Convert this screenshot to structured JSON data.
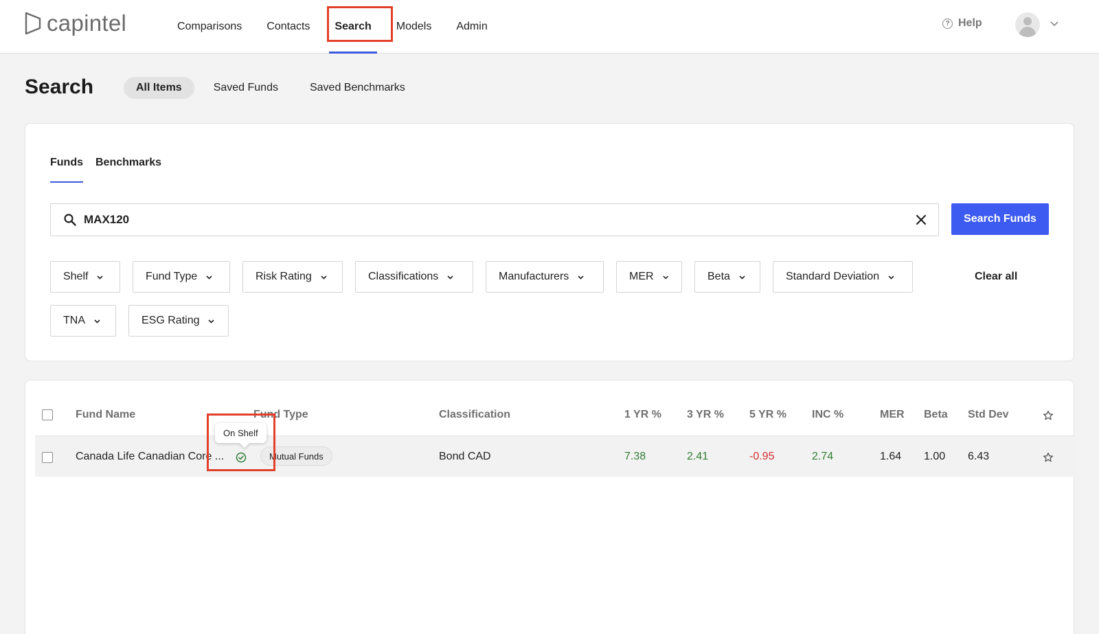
{
  "brand": {
    "name": "capintel"
  },
  "nav": {
    "items": [
      "Comparisons",
      "Contacts",
      "Search",
      "Models",
      "Admin"
    ],
    "active": "Search"
  },
  "header": {
    "help_label": "Help"
  },
  "page": {
    "title": "Search",
    "subtabs": [
      "All Items",
      "Saved Funds",
      "Saved Benchmarks"
    ],
    "active_subtab": "All Items"
  },
  "search_card": {
    "tabs": [
      "Funds",
      "Benchmarks"
    ],
    "active_tab": "Funds",
    "query": "MAX120",
    "search_button": "Search Funds",
    "filters": [
      "Shelf",
      "Fund Type",
      "Risk Rating",
      "Classifications",
      "Manufacturers",
      "MER",
      "Beta",
      "Standard Deviation",
      "TNA",
      "ESG Rating"
    ],
    "clear_all": "Clear all"
  },
  "table": {
    "headers": [
      "Fund Name",
      "Fund Type",
      "Classification",
      "1 YR %",
      "3 YR %",
      "5 YR %",
      "INC %",
      "MER",
      "Beta",
      "Std Dev"
    ],
    "rows": [
      {
        "fund_name": "Canada Life Canadian Core ...",
        "fund_type": "Mutual Funds",
        "classification": "Bond CAD",
        "yr1": "7.38",
        "yr3": "2.41",
        "yr5": "-0.95",
        "inc": "2.74",
        "mer": "1.64",
        "beta": "1.00",
        "std_dev": "6.43",
        "shelf_status": "On Shelf"
      }
    ]
  },
  "colors": {
    "accent": "#3d5af1",
    "positive": "#2e7d32",
    "negative": "#d32f2f",
    "highlight": "#e2402a"
  },
  "icons": {
    "search": "search-icon",
    "clear": "close-icon",
    "shelf": "check-circle-icon",
    "favorite": "star-icon",
    "dropdown": "chevron-down-icon"
  }
}
